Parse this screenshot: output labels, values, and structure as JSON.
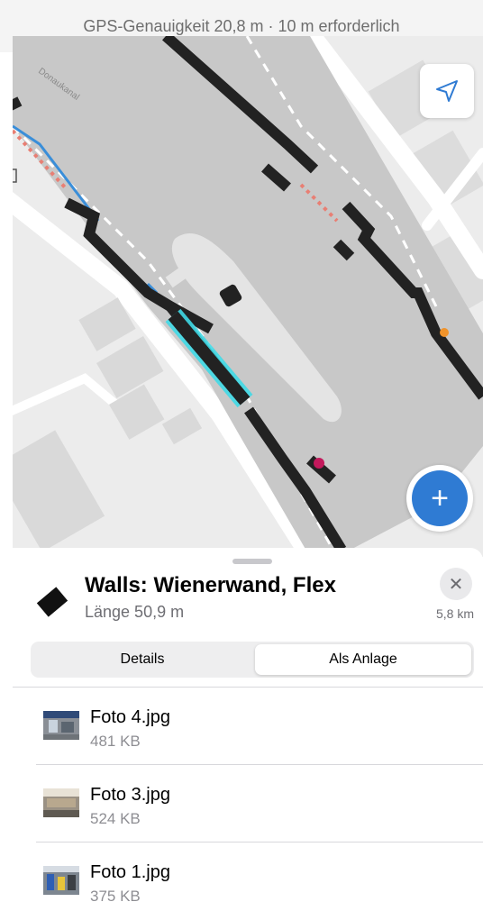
{
  "gps_status": "GPS-Genauigkeit 20,8 m · 10 m erforderlich",
  "map": {
    "water_label": "Donaukanal",
    "locate_icon": "navigation-arrow-icon",
    "add_icon": "plus-icon",
    "add_label": "+"
  },
  "sheet": {
    "title": "Walls: Wienerwand, Flex",
    "subtitle": "Länge 50,9 m",
    "distance": "5,8 km",
    "close_label": "✕",
    "tabs": [
      {
        "label": "Details",
        "selected": false
      },
      {
        "label": "Als Anlage",
        "selected": true
      }
    ],
    "attachments": [
      {
        "name": "Foto 4.jpg",
        "size": "481 KB"
      },
      {
        "name": "Foto 3.jpg",
        "size": "524 KB"
      },
      {
        "name": "Foto 1.jpg",
        "size": "375 KB"
      }
    ]
  },
  "colors": {
    "fab": "#2f7bd3",
    "selection": "#3fd9e6",
    "wall": "#222222"
  }
}
